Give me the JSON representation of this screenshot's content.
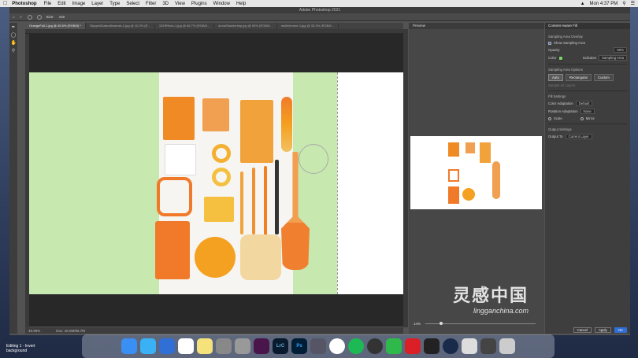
{
  "menubar": {
    "app_name": "Photoshop",
    "items": [
      "File",
      "Edit",
      "Image",
      "Layer",
      "Type",
      "Select",
      "Filter",
      "3D",
      "View",
      "Plugins",
      "Window",
      "Help"
    ],
    "clock": "Mon 4:37 PM"
  },
  "window": {
    "title": "Adobe Photoshop 2021"
  },
  "options": {
    "size_label": "Size:",
    "size_value": "418"
  },
  "tabs": [
    "OrangeFull-1.jpg @ 45.6% (RGB/8) *",
    "SkippedDatsutilmanals-2.jpg @ 10.2% (R...",
    "1DHRfrom-1.jpg @ 66.7% (RGB/8...",
    "donutStackerimp.jpg @ 50% (RGB/8...",
    "multichrome-1.jpg @ 33.3% (RGB/8..."
  ],
  "status": {
    "zoom": "45.59%",
    "doc": "Doc: 48.0M/96.7M"
  },
  "preview": {
    "title": "Preview",
    "zoom": "14%"
  },
  "caf": {
    "title": "Content-Aware Fill",
    "overlay_section": "Sampling Area Overlay",
    "show_sampling": "Show Sampling Area",
    "opacity_label": "Opacity",
    "opacity_value": "50%",
    "color_label": "Color",
    "indicates_label": "Indicates",
    "indicates_value": "Sampling Area",
    "options_section": "Sampling Area Options",
    "btn_auto": "Auto",
    "btn_rect": "Rectangular",
    "btn_custom": "Custom",
    "sample_all": "Sample All Layers",
    "fill_section": "Fill Settings",
    "color_adapt_label": "Color Adaptation",
    "color_adapt_value": "Default",
    "rotation_label": "Rotation Adaptation",
    "rotation_value": "None",
    "scale": "Scale",
    "mirror": "Mirror",
    "output_section": "Output Settings",
    "output_label": "Output To",
    "output_value": "Current Layer",
    "cancel": "Cancel",
    "apply": "Apply",
    "ok": "OK",
    "overlay_color": "#7ed36b"
  },
  "editing": {
    "line1": "Editing 1 - Invert",
    "line2": "background"
  },
  "dock_items": [
    "Finder",
    "Messages",
    "Tasks",
    "Calendar",
    "Notes",
    "Keynote",
    "Settings",
    "Slack",
    "LrC",
    "Ps",
    "App",
    "Chrome",
    "Spotify",
    "QuickTime",
    "FaceTime",
    "CC",
    "Motion",
    "1Pass",
    "Preview",
    "Folder",
    "Trash"
  ],
  "watermark": {
    "cn": "灵感中国",
    "en": "lingganchina.com"
  }
}
